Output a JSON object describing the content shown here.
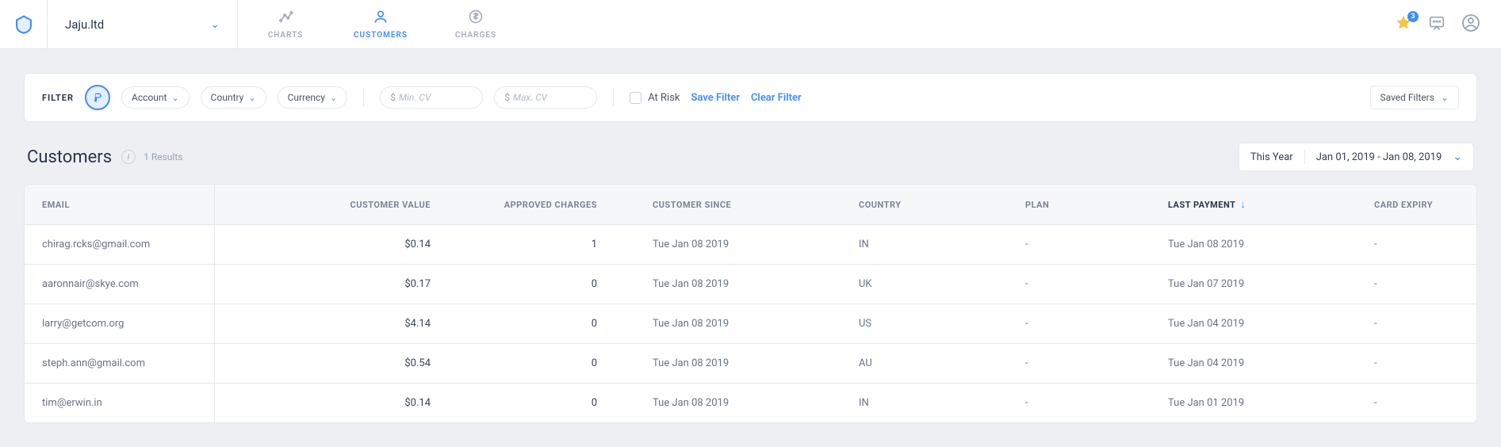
{
  "header": {
    "org": "Jaju.ltd",
    "nav": {
      "charts": "CHARTS",
      "customers": "CUSTOMERS",
      "charges": "CHARGES"
    },
    "star_badge": "3"
  },
  "filter": {
    "label": "FILTER",
    "account": "Account",
    "country": "Country",
    "currency": "Currency",
    "min_placeholder": "Min. CV",
    "max_placeholder": "Max. CV",
    "at_risk": "At Risk",
    "save": "Save Filter",
    "clear": "Clear Filter",
    "saved": "Saved Filters"
  },
  "title": {
    "heading": "Customers",
    "results": "1 Results",
    "range_label": "This Year",
    "range": "Jan 01, 2019 - Jan 08, 2019"
  },
  "columns": {
    "email": "EMAIL",
    "value": "CUSTOMER VALUE",
    "approved": "APPROVED CHARGES",
    "since": "CUSTOMER SINCE",
    "country": "COUNTRY",
    "plan": "PLAN",
    "last": "LAST PAYMENT",
    "expiry": "CARD EXPIRY"
  },
  "rows": [
    {
      "email": "chirag.rcks@gmail.com",
      "value": "$0.14",
      "approved": "1",
      "since": "Tue Jan 08 2019",
      "country": "IN",
      "plan": "-",
      "last": "Tue Jan 08 2019",
      "expiry": "-"
    },
    {
      "email": "aaronnair@skye.com",
      "value": "$0.17",
      "approved": "0",
      "since": "Tue Jan 08 2019",
      "country": "UK",
      "plan": "-",
      "last": "Tue Jan 07 2019",
      "expiry": "-"
    },
    {
      "email": "larry@getcom.org",
      "value": "$4.14",
      "approved": "0",
      "since": "Tue Jan 08 2019",
      "country": "US",
      "plan": "-",
      "last": "Tue Jan 04 2019",
      "expiry": "-"
    },
    {
      "email": "steph.ann@gmail.com",
      "value": "$0.54",
      "approved": "0",
      "since": "Tue Jan 08 2019",
      "country": "AU",
      "plan": "-",
      "last": "Tue Jan 04 2019",
      "expiry": "-"
    },
    {
      "email": "tim@erwin.in",
      "value": "$0.14",
      "approved": "0",
      "since": "Tue Jan 08 2019",
      "country": "IN",
      "plan": "-",
      "last": "Tue Jan 01 2019",
      "expiry": "-"
    }
  ]
}
